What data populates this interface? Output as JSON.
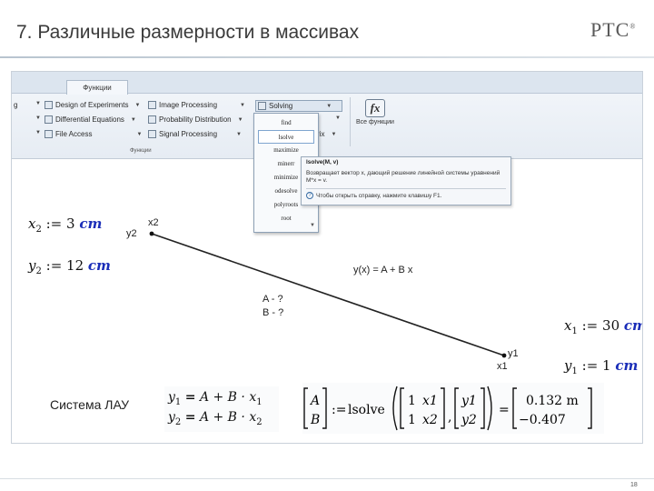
{
  "slide": {
    "title": "7. Различные размерности в массивах",
    "logo": "PTC",
    "page_number": "18"
  },
  "ribbon": {
    "tab_label": "Функции",
    "group_label": "Функции",
    "items": [
      {
        "label": "Design of Experiments"
      },
      {
        "label": "Differential Equations"
      },
      {
        "label": "File Access"
      },
      {
        "label": "Image Processing"
      },
      {
        "label": "Probability Distribution"
      },
      {
        "label": "Signal Processing"
      },
      {
        "label": "Solving"
      }
    ],
    "partial_left_label": "g",
    "partial_mid_label": "rix",
    "all_functions_label": "Все функции",
    "fx_glyph": "fx"
  },
  "solving_menu": {
    "items": [
      "find",
      "lsolve",
      "maximize",
      "minerr",
      "minimize",
      "odesolve",
      "polyroots",
      "root"
    ],
    "selected": "lsolve"
  },
  "tooltip": {
    "title": "lsolve(M, v)",
    "description": "Возвращает вектор x, дающий решение линейной системы уравнений M*x = v.",
    "help": "Чтобы открыть справку, нажмите клавишу F1."
  },
  "worksheet": {
    "x2": {
      "var": "x",
      "sub": "2",
      "op": ":=",
      "value": "3",
      "unit": "cm"
    },
    "y2": {
      "var": "y",
      "sub": "2",
      "op": ":=",
      "value": "12",
      "unit": "cm"
    },
    "x1": {
      "var": "x",
      "sub": "1",
      "op": ":=",
      "value": "30",
      "unit": "cm"
    },
    "y1": {
      "var": "y",
      "sub": "1",
      "op": ":=",
      "value": "1",
      "unit": "cm"
    },
    "system_label": "Система ЛАУ",
    "eq1": {
      "lhs": "y",
      "lhs_sub": "1",
      "rhs": "A + B · x",
      "rhs_sub": "1",
      "op": "="
    },
    "eq2": {
      "lhs": "y",
      "lhs_sub": "2",
      "rhs": "A + B · x",
      "rhs_sub": "2",
      "op": "="
    },
    "solve": {
      "unknowns": [
        "A",
        "B"
      ],
      "assign": ":=",
      "func": "lsolve",
      "matrix": [
        [
          "1",
          "x1"
        ],
        [
          "1",
          "x2"
        ]
      ],
      "vector": [
        "y1",
        "y2"
      ],
      "result": [
        "0.132 m",
        "−0.407"
      ]
    }
  },
  "plot": {
    "label_y2": "y2",
    "label_x2": "x2",
    "label_y1": "y1",
    "label_x1": "x1",
    "equation": "y(x) = A + B x",
    "unknown_a": "A - ?",
    "unknown_b": "B - ?"
  },
  "colors": {
    "unit_blue": "#1a2db8",
    "ribbon_bg": "#e6ecf3"
  }
}
